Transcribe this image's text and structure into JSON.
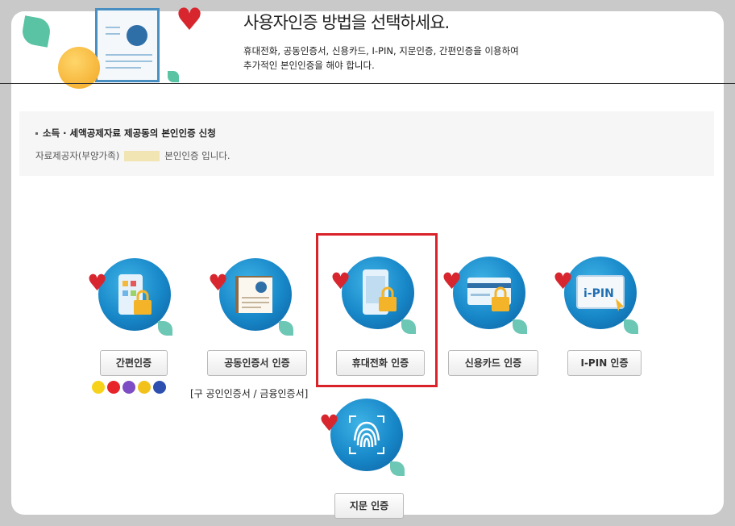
{
  "header": {
    "title": "사용자인증 방법을 선택하세요.",
    "desc_line1": "휴대전화, 공동인증서, 신용카드, I-PIN, 지문인증, 간편인증을 이용하여",
    "desc_line2": "추가적인 본인인증을 해야 합니다."
  },
  "info": {
    "title": "소득 · 세액공제자료 제공동의 본인인증 신청",
    "line_prefix": "자료제공자(부양가족)",
    "line_suffix": "본인인증 입니다."
  },
  "methods": [
    {
      "label": "간편인증",
      "icon": "simple-auth-icon"
    },
    {
      "label": "공동인증서 인증",
      "icon": "certificate-icon"
    },
    {
      "label": "휴대전화 인증",
      "icon": "mobile-phone-icon"
    },
    {
      "label": "신용카드 인증",
      "icon": "credit-card-icon"
    },
    {
      "label": "I-PIN 인증",
      "icon": "ipin-icon"
    },
    {
      "label": "지문 인증",
      "icon": "fingerprint-icon"
    }
  ],
  "ipin_screen_text": "i-PIN",
  "certificate_note": "[구 공인인증서 / 금융인증서]",
  "selected_method": "휴대전화 인증",
  "colors": {
    "accent_red": "#d9222a",
    "icon_blue": "#1787c8",
    "heart": "#d8262f",
    "leaf": "#6dc7b5"
  }
}
